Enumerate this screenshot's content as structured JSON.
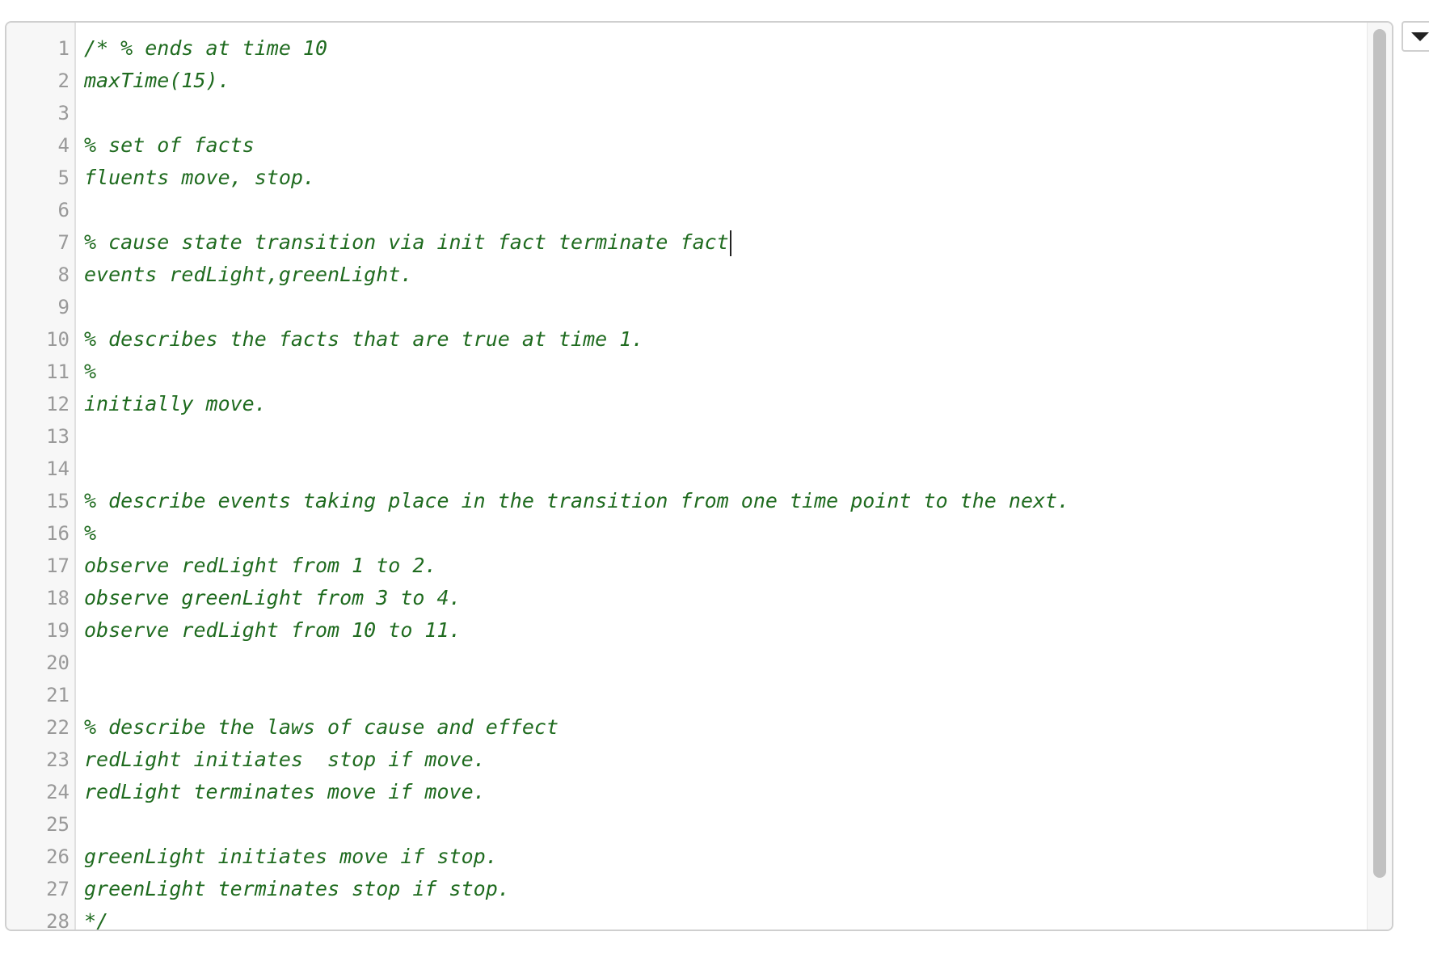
{
  "editor": {
    "lines": [
      {
        "num": "1",
        "text": "/* % ends at time 10"
      },
      {
        "num": "2",
        "text": "maxTime(15)."
      },
      {
        "num": "3",
        "text": ""
      },
      {
        "num": "4",
        "text": "% set of facts"
      },
      {
        "num": "5",
        "text": "fluents move, stop."
      },
      {
        "num": "6",
        "text": ""
      },
      {
        "num": "7",
        "text": "% cause state transition via init fact terminate fact"
      },
      {
        "num": "8",
        "text": "events redLight,greenLight."
      },
      {
        "num": "9",
        "text": ""
      },
      {
        "num": "10",
        "text": "% describes the facts that are true at time 1."
      },
      {
        "num": "11",
        "text": "%"
      },
      {
        "num": "12",
        "text": "initially move."
      },
      {
        "num": "13",
        "text": ""
      },
      {
        "num": "14",
        "text": ""
      },
      {
        "num": "15",
        "text": "% describe events taking place in the transition from one time point to the next."
      },
      {
        "num": "16",
        "text": "%"
      },
      {
        "num": "17",
        "text": "observe redLight from 1 to 2."
      },
      {
        "num": "18",
        "text": "observe greenLight from 3 to 4."
      },
      {
        "num": "19",
        "text": "observe redLight from 10 to 11."
      },
      {
        "num": "20",
        "text": ""
      },
      {
        "num": "21",
        "text": ""
      },
      {
        "num": "22",
        "text": "% describe the laws of cause and effect"
      },
      {
        "num": "23",
        "text": "redLight initiates  stop if move."
      },
      {
        "num": "24",
        "text": "redLight terminates move if move."
      },
      {
        "num": "25",
        "text": ""
      },
      {
        "num": "26",
        "text": "greenLight initiates move if stop."
      },
      {
        "num": "27",
        "text": "greenLight terminates stop if stop."
      },
      {
        "num": "28",
        "text": "*/"
      }
    ],
    "cursor_line": 7,
    "colors": {
      "code_text": "#1f6b1f",
      "line_number": "#999999",
      "gutter_bg": "#f7f7f7"
    }
  },
  "toolbar": {
    "dropdown_icon": "chevron-down-icon"
  }
}
